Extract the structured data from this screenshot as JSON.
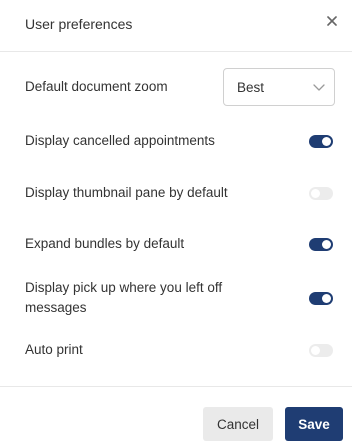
{
  "dialog": {
    "title": "User preferences",
    "close_icon": "close-icon"
  },
  "zoom": {
    "label": "Default document zoom",
    "selected": "Best",
    "chevron_icon": "chevron-down-icon"
  },
  "settings": [
    {
      "label": "Display cancelled appointments",
      "enabled": true
    },
    {
      "label": "Display thumbnail pane by default",
      "enabled": false
    },
    {
      "label": "Expand bundles by default",
      "enabled": true
    },
    {
      "label": "Display pick up where you left off messages",
      "enabled": true
    },
    {
      "label": "Auto print",
      "enabled": false
    }
  ],
  "colors": {
    "toggle_on": "#1f3d73",
    "toggle_off": "#ececec",
    "primary_button": "#1f3d73",
    "secondary_button": "#eaeaea"
  },
  "footer": {
    "cancel_label": "Cancel",
    "save_label": "Save"
  }
}
